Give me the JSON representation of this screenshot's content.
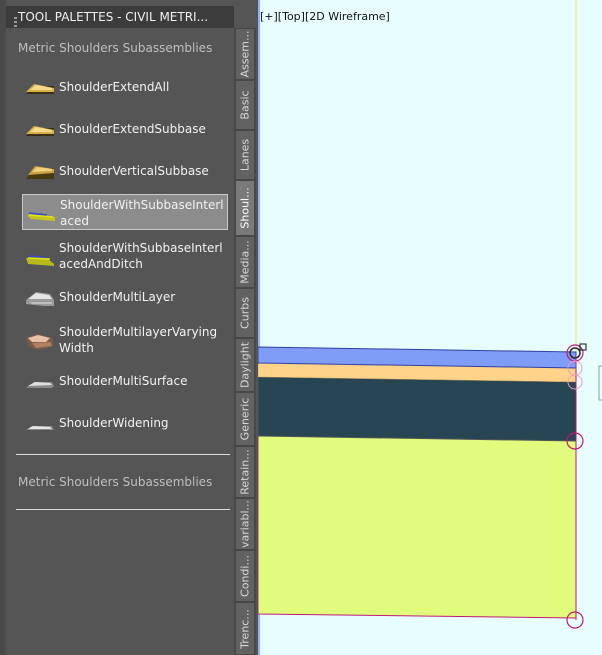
{
  "palette": {
    "title": "TOOL PALETTES - CIVIL METRI...",
    "section_header": "Metric Shoulders Subassemblies",
    "section_footer": "Metric Shoulders Subassemblies",
    "items": [
      {
        "label": "ShoulderExtendAll",
        "icon": "shoulder-extend-all-icon"
      },
      {
        "label": "ShoulderExtendSubbase",
        "icon": "shoulder-extend-subbase-icon"
      },
      {
        "label": "ShoulderVerticalSubbase",
        "icon": "shoulder-vertical-subbase-icon"
      },
      {
        "label": "ShoulderWithSubbaseInterlaced",
        "icon": "shoulder-interlaced-icon",
        "selected": true
      },
      {
        "label": "ShoulderWithSubbaseInterlacedAndDitch",
        "icon": "shoulder-interlaced-ditch-icon"
      },
      {
        "label": "ShoulderMultiLayer",
        "icon": "shoulder-multilayer-icon"
      },
      {
        "label": "ShoulderMultilayerVaryingWidth",
        "icon": "shoulder-multilayer-varying-icon"
      },
      {
        "label": "ShoulderMultiSurface",
        "icon": "shoulder-multisurface-icon"
      },
      {
        "label": "ShoulderWidening",
        "icon": "shoulder-widening-icon"
      }
    ],
    "tabs": [
      "Assem...",
      "Basic",
      "Lanes",
      "Shoul...",
      "Media...",
      "Curbs",
      "Daylight",
      "Generic",
      "Retain...",
      "variabl...",
      "Condi...",
      "Trenc..."
    ],
    "active_tab": "Shoul..."
  },
  "viewport": {
    "label": "[+][Top][2D Wireframe]"
  },
  "colors": {
    "palette_bg": "#555555",
    "viewport_bg": "#e8fefe",
    "layer_blue": "#7f9cf7",
    "layer_orange": "#ffd38a",
    "layer_dark": "#274553",
    "layer_green": "#e1fc7c",
    "marker_magenta": "#c0187a"
  }
}
